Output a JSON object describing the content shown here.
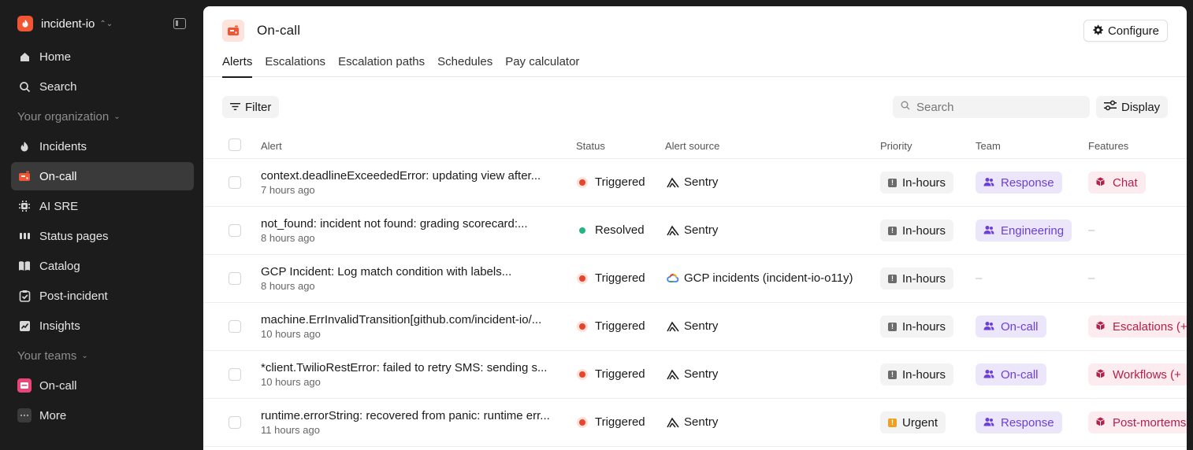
{
  "sidebar": {
    "org_name": "incident-io",
    "items_top": [
      {
        "label": "Home",
        "icon": "home-icon"
      },
      {
        "label": "Search",
        "icon": "search-icon"
      }
    ],
    "org_section": "Your organization",
    "items_org": [
      {
        "label": "Incidents",
        "icon": "flame-icon"
      },
      {
        "label": "On-call",
        "icon": "pager-icon"
      },
      {
        "label": "AI SRE",
        "icon": "ai-icon"
      },
      {
        "label": "Status pages",
        "icon": "status-bars-icon"
      },
      {
        "label": "Catalog",
        "icon": "book-icon"
      },
      {
        "label": "Post-incident",
        "icon": "clipboard-check-icon"
      },
      {
        "label": "Insights",
        "icon": "chart-icon"
      }
    ],
    "teams_section": "Your teams",
    "items_teams": [
      {
        "label": "On-call",
        "icon": "team-oncall-icon"
      },
      {
        "label": "More",
        "icon": "more-icon"
      }
    ]
  },
  "header": {
    "title": "On-call",
    "configure_label": "Configure",
    "tabs": [
      "Alerts",
      "Escalations",
      "Escalation paths",
      "Schedules",
      "Pay calculator"
    ]
  },
  "toolbar": {
    "filter_label": "Filter",
    "search_placeholder": "Search",
    "display_label": "Display"
  },
  "table": {
    "columns": [
      "Alert",
      "Status",
      "Alert source",
      "Priority",
      "Team",
      "Features"
    ],
    "rows": [
      {
        "title": "context.deadlineExceededError: updating view after...",
        "time": "7 hours ago",
        "status": "Triggered",
        "source": "Sentry",
        "priority": "In-hours",
        "team": "Response",
        "feature": "Chat"
      },
      {
        "title": "not_found: incident not found: grading scorecard:...",
        "time": "8 hours ago",
        "status": "Resolved",
        "source": "Sentry",
        "priority": "In-hours",
        "team": "Engineering",
        "feature": "–"
      },
      {
        "title": "GCP Incident: Log match condition with labels...",
        "time": "8 hours ago",
        "status": "Triggered",
        "source": "GCP incidents (incident-io-o11y)",
        "priority": "In-hours",
        "team": "–",
        "feature": "–"
      },
      {
        "title": "machine.ErrInvalidTransition[github.com/incident-io/...",
        "time": "10 hours ago",
        "status": "Triggered",
        "source": "Sentry",
        "priority": "In-hours",
        "team": "On-call",
        "feature": "Escalations (+"
      },
      {
        "title": "*client.TwilioRestError: failed to retry SMS: sending s...",
        "time": "10 hours ago",
        "status": "Triggered",
        "source": "Sentry",
        "priority": "In-hours",
        "team": "On-call",
        "feature": "Workflows (+"
      },
      {
        "title": "runtime.errorString: recovered from panic: runtime err...",
        "time": "11 hours ago",
        "status": "Triggered",
        "source": "Sentry",
        "priority": "Urgent",
        "team": "Response",
        "feature": "Post-mortems"
      }
    ]
  },
  "colors": {
    "brand": "#f25533",
    "triggered": "#e6452b",
    "resolved": "#21b57f",
    "team_bg": "#ece6fb",
    "team_fg": "#6c3fd6",
    "feature_bg": "#fdecef",
    "feature_fg": "#b3204a",
    "urgent": "#f0a020"
  }
}
